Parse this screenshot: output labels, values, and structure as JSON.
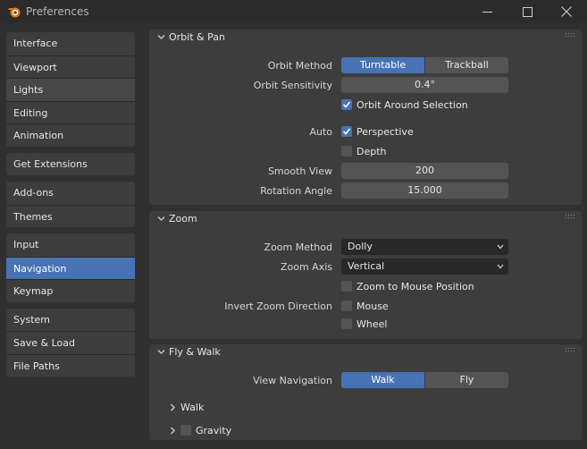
{
  "window": {
    "title": "Preferences"
  },
  "sidebar": {
    "groups": [
      [
        "Interface",
        "Viewport",
        "Lights",
        "Editing",
        "Animation"
      ],
      [
        "Get Extensions"
      ],
      [
        "Add-ons",
        "Themes"
      ],
      [
        "Input",
        "Navigation",
        "Keymap"
      ],
      [
        "System",
        "Save & Load",
        "File Paths"
      ]
    ],
    "active": "Navigation",
    "hovered": "Lights"
  },
  "orbit": {
    "title": "Orbit & Pan",
    "orbit_method_label": "Orbit Method",
    "orbit_method_options": [
      "Turntable",
      "Trackball"
    ],
    "orbit_method_selected": "Turntable",
    "orbit_sensitivity_label": "Orbit Sensitivity",
    "orbit_sensitivity_value": "0.4°",
    "orbit_around_selection_label": "Orbit Around Selection",
    "orbit_around_selection_checked": true,
    "auto_label": "Auto",
    "perspective_label": "Perspective",
    "perspective_checked": true,
    "depth_label": "Depth",
    "depth_checked": false,
    "smooth_view_label": "Smooth View",
    "smooth_view_value": "200",
    "rotation_angle_label": "Rotation Angle",
    "rotation_angle_value": "15.000"
  },
  "zoom": {
    "title": "Zoom",
    "zoom_method_label": "Zoom Method",
    "zoom_method_value": "Dolly",
    "zoom_axis_label": "Zoom Axis",
    "zoom_axis_value": "Vertical",
    "zoom_to_mouse_label": "Zoom to Mouse Position",
    "zoom_to_mouse_checked": false,
    "invert_label": "Invert Zoom Direction",
    "mouse_label": "Mouse",
    "mouse_checked": false,
    "wheel_label": "Wheel",
    "wheel_checked": false
  },
  "fly": {
    "title": "Fly & Walk",
    "view_navigation_label": "View Navigation",
    "view_navigation_options": [
      "Walk",
      "Fly"
    ],
    "view_navigation_selected": "Walk",
    "walk_label": "Walk",
    "gravity_label": "Gravity",
    "gravity_checked": false
  },
  "colors": {
    "accent": "#4772b3",
    "background": "#303030",
    "panel": "#3d3d3d",
    "widget": "#545454",
    "dropdown": "#282828"
  },
  "icons": [
    "blender-logo-icon",
    "minimize-icon",
    "maximize-icon",
    "close-icon",
    "chevron-down-icon",
    "chevron-right-icon",
    "grip-icon",
    "checkmark-icon",
    "dropdown-arrow-icon"
  ]
}
